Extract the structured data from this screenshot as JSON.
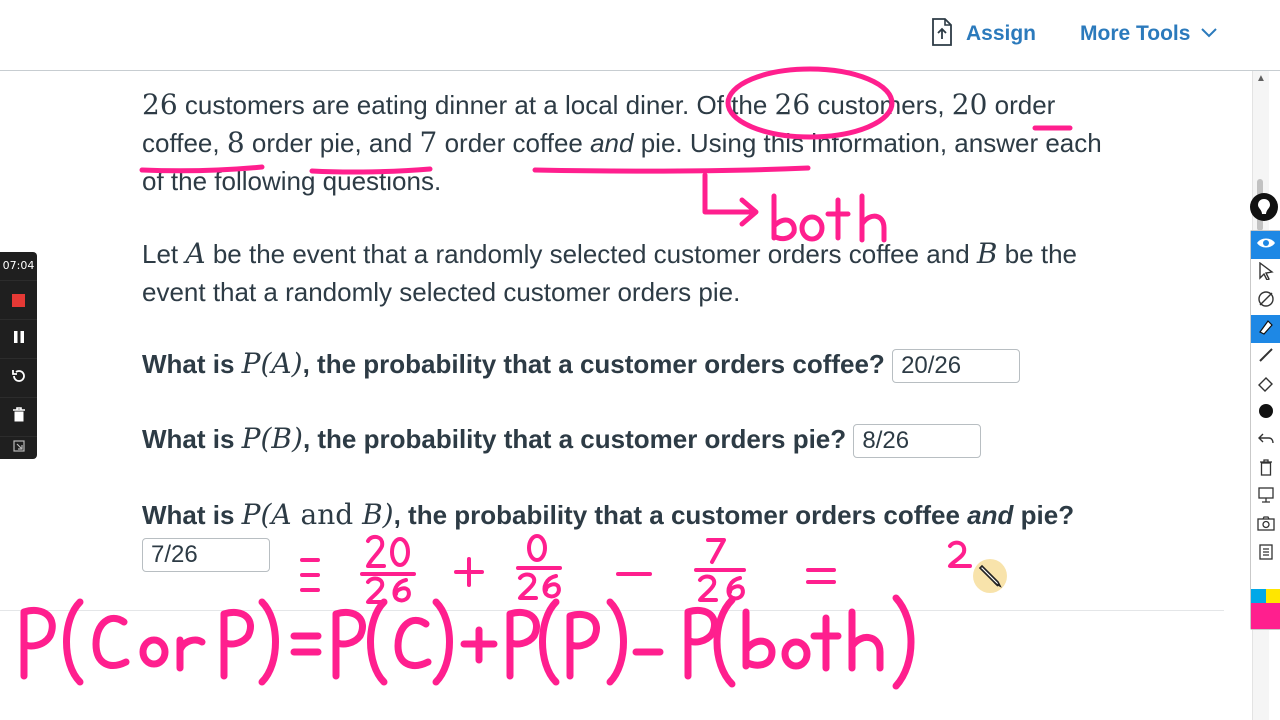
{
  "header": {
    "assign_label": "Assign",
    "more_tools_label": "More Tools"
  },
  "problem": {
    "p1_num_total": "26",
    "p1_a": " customers are eating dinner at a local diner. Of the ",
    "p1_num_total2": "26",
    "p1_b": " customers, ",
    "p1_num_coffee": "20",
    "p1_c": " order coffee, ",
    "p1_num_pie": "8",
    "p1_d": " order pie, and ",
    "p1_num_both": "7",
    "p1_e": " order coffee ",
    "p1_and": "and",
    "p1_f": " pie. Using this information, answer each of the following questions.",
    "p2_a": "Let ",
    "p2_A": "A",
    "p2_b": " be the event that a randomly selected customer orders coffee and ",
    "p2_B": "B",
    "p2_c": " be the event that a randomly selected customer orders pie."
  },
  "questions": {
    "q1_a": "What is ",
    "q1_math": "P(A)",
    "q1_b": ", the probability that a customer orders coffee?",
    "q1_answer": "20/26",
    "q2_a": "What is ",
    "q2_math": "P(B)",
    "q2_b": ", the probability that a customer orders pie?",
    "q2_answer": "8/26",
    "q3_a": "What is ",
    "q3_math_a": "P(A",
    "q3_math_and": " and ",
    "q3_math_b": "B)",
    "q3_b": ", the probability that a customer orders coffee ",
    "q3_and": "and",
    "q3_c": " pie?",
    "q3_answer": "7/26"
  },
  "recorder": {
    "time": "07:04"
  },
  "colors": {
    "accent": "#2b7abc",
    "ink": "#ff1f8e",
    "text": "#2d3b45",
    "tool_active": "#1e88e5"
  },
  "icons": {
    "assign": "document-upload-icon",
    "more_tools": "chevron-down-icon",
    "toolbar": [
      "pen-logo-icon",
      "eye-icon",
      "cursor-icon",
      "pen-off-icon",
      "highlighter-icon",
      "line-icon",
      "eraser-icon",
      "dot-icon",
      "undo-icon",
      "trash-icon",
      "presentation-icon",
      "camera-icon",
      "clipboard-icon"
    ]
  }
}
